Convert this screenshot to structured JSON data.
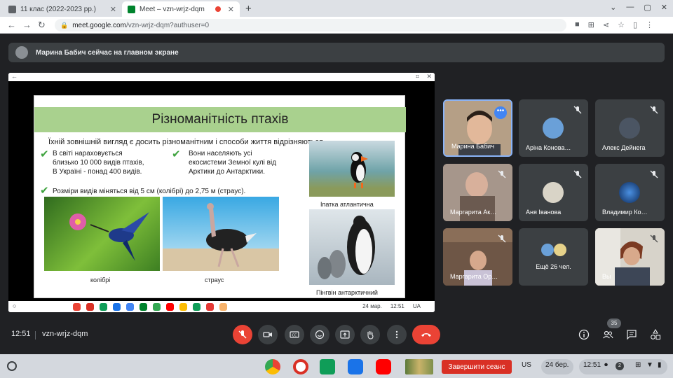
{
  "browser": {
    "tabs": [
      {
        "title": "11 клас (2022-2023 рр.)",
        "active": false
      },
      {
        "title": "Meet – vzn-wrjz-dqm",
        "active": true
      }
    ],
    "url_host": "meet.google.com",
    "url_path": "/vzn-wrjz-dqm?authuser=0"
  },
  "meet": {
    "banner": "Марина Бабич сейчас на главном экране",
    "time": "12:51",
    "meeting_code": "vzn-wrjz-dqm",
    "participants_count": "35",
    "tiles": [
      {
        "name": "Марина Бабич",
        "muted": false,
        "active": true
      },
      {
        "name": "Аріна Конова…",
        "muted": true
      },
      {
        "name": "Алекс Дейнега",
        "muted": true
      },
      {
        "name": "Маргарита Ак…",
        "muted": true
      },
      {
        "name": "Аня Іванова",
        "muted": true
      },
      {
        "name": "Владимир Ко…",
        "muted": true
      },
      {
        "name": "Маргарита Ор…",
        "muted": true
      },
      {
        "name": "Ещё 26 чел.",
        "muted": false
      },
      {
        "name": "Вы",
        "muted": true
      }
    ]
  },
  "slide": {
    "title": "Різноманітність птахів",
    "subtitle": "Їхній зовнішній вигляд є досить різноманітним і способи життя відрізняються.",
    "point1_line1": "В світі нараховується",
    "point1_line2": "близько 10 000 видів птахів,",
    "point1_line3": "В Україні - понад 400 видів.",
    "point2_line1": "Вони населяють усі",
    "point2_line2": "екосистеми Земної кулі від",
    "point2_line3": "Арктики до Антарктики.",
    "point3": "Розміри видів міняться від 5 см (колібрі) до 2,75 м (страус).",
    "caption_hummingbird": "колібрі",
    "caption_ostrich": "страус",
    "caption_puffin": "Іпатка атлантична",
    "caption_penguin": "Пінгвін антарктичний"
  },
  "shared_screen_status": {
    "date": "24 мар.",
    "time": "12:51",
    "lang": "UA"
  },
  "shelf": {
    "end_session": "Завершити сеанс",
    "lang": "US",
    "date": "24 бер.",
    "time": "12:51",
    "notif_count": "2"
  },
  "colors": {
    "meet_bg": "#202124",
    "tile_bg": "#3c4043",
    "end_call": "#ea4335",
    "slide_title_bg": "#a9d18e",
    "check_green": "#3fa33f"
  }
}
